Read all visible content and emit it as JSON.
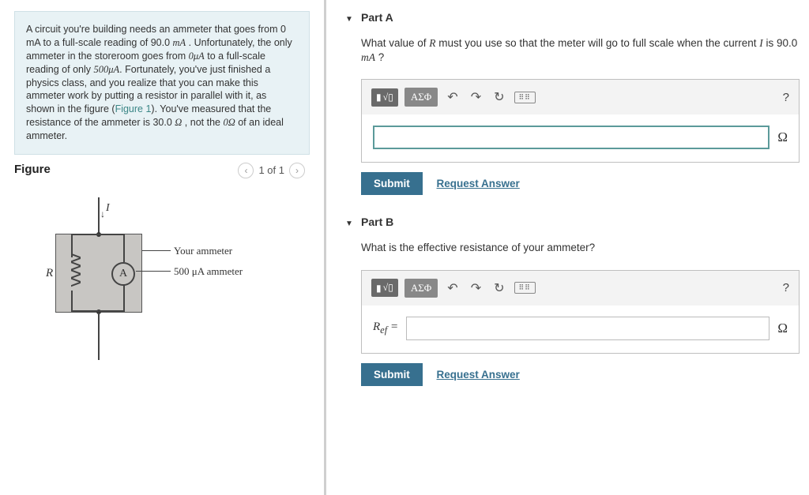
{
  "problem": {
    "text_pre": "A circuit you're building needs an ammeter that goes from 0 mA to a full-scale reading of 90.0 ",
    "unit1": "mA",
    "text_2": " . Unfortunately, the only ammeter in the storeroom goes from ",
    "val2": "0μA",
    "text_3": " to a full-scale reading of only ",
    "val3": "500μA",
    "text_4": ". Fortunately, you've just finished a physics class, and you realize that you can make this ammeter work by putting a resistor in parallel with it, as shown in the figure (",
    "figref": "Figure 1",
    "text_5": "). You've measured that the resistance of the ammeter is 30.0 ",
    "ohm": "Ω",
    "text_6": " , not the ",
    "zeroohm": "0Ω",
    "text_7": " of an ideal ammeter."
  },
  "figure": {
    "title": "Figure",
    "pager": "1 of 1",
    "label_I": "I",
    "label_R": "R",
    "label_A": "A",
    "label_your": "Your ammeter",
    "label_500": "500 μA ammeter"
  },
  "partA": {
    "header": "Part A",
    "question_pre": "What value of ",
    "var1": "R",
    "question_mid": " must you use so that the meter will go to full scale when the current ",
    "var2": "I",
    "question_post": " is 90.0 ",
    "unit": "mA",
    "question_end": " ?",
    "answer_unit": "Ω",
    "greek_btn": "ΑΣΦ",
    "submit": "Submit",
    "request": "Request Answer"
  },
  "partB": {
    "header": "Part B",
    "question": "What is the effective resistance of your ammeter?",
    "answer_label_pre": "R",
    "answer_label_sub": "ef",
    "answer_label_eq": " = ",
    "answer_unit": "Ω",
    "greek_btn": "ΑΣΦ",
    "submit": "Submit",
    "request": "Request Answer"
  },
  "toolbar": {
    "help": "?",
    "kbd": "⌨"
  }
}
